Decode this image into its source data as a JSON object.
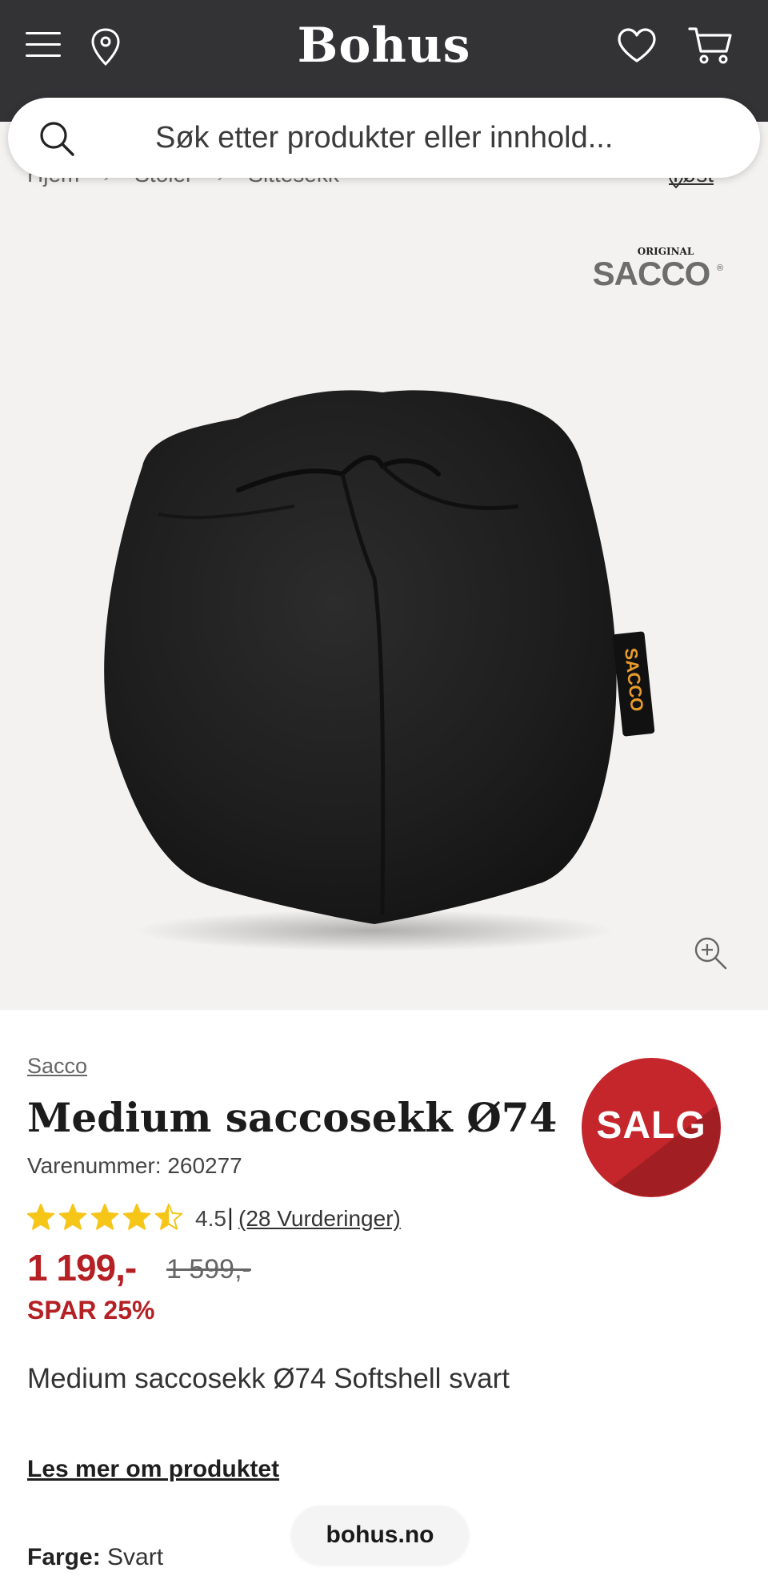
{
  "header": {
    "logo": "Bohus",
    "icons": [
      "menu-icon",
      "location-pin-icon",
      "heart-icon",
      "cart-icon"
    ]
  },
  "search": {
    "placeholder": "Søk etter produkter eller innhold..."
  },
  "breadcrumb": {
    "items": [
      "Hjem",
      "Stoler",
      "Sittesekk"
    ],
    "store_link": "Tøst"
  },
  "gallery": {
    "brand_logo_top": "ORIGINAL",
    "brand_logo_main": "SACCO"
  },
  "product": {
    "brand": "Sacco",
    "title": "Medium saccosekk Ø74",
    "sku": "Varenummer: 260277",
    "sale_badge": "SALG",
    "rating": {
      "value": "4.5",
      "stars": 4.5,
      "max": 5,
      "reviews_link": "(28 Vurderinger)"
    },
    "price": "1 199,-",
    "old_price": "1 599,-",
    "savings": "SPAR 25%",
    "description": "Medium saccosekk Ø74 Softshell svart",
    "read_more": "Les mer om produktet",
    "color_label": "Farge:",
    "color_value": "Svart"
  },
  "footer": {
    "domain": "bohus.no"
  },
  "colors": {
    "header_bg": "#333336",
    "price_red": "#b52025",
    "star_yellow": "#f5c518",
    "image_bg": "#f3f2f0"
  }
}
